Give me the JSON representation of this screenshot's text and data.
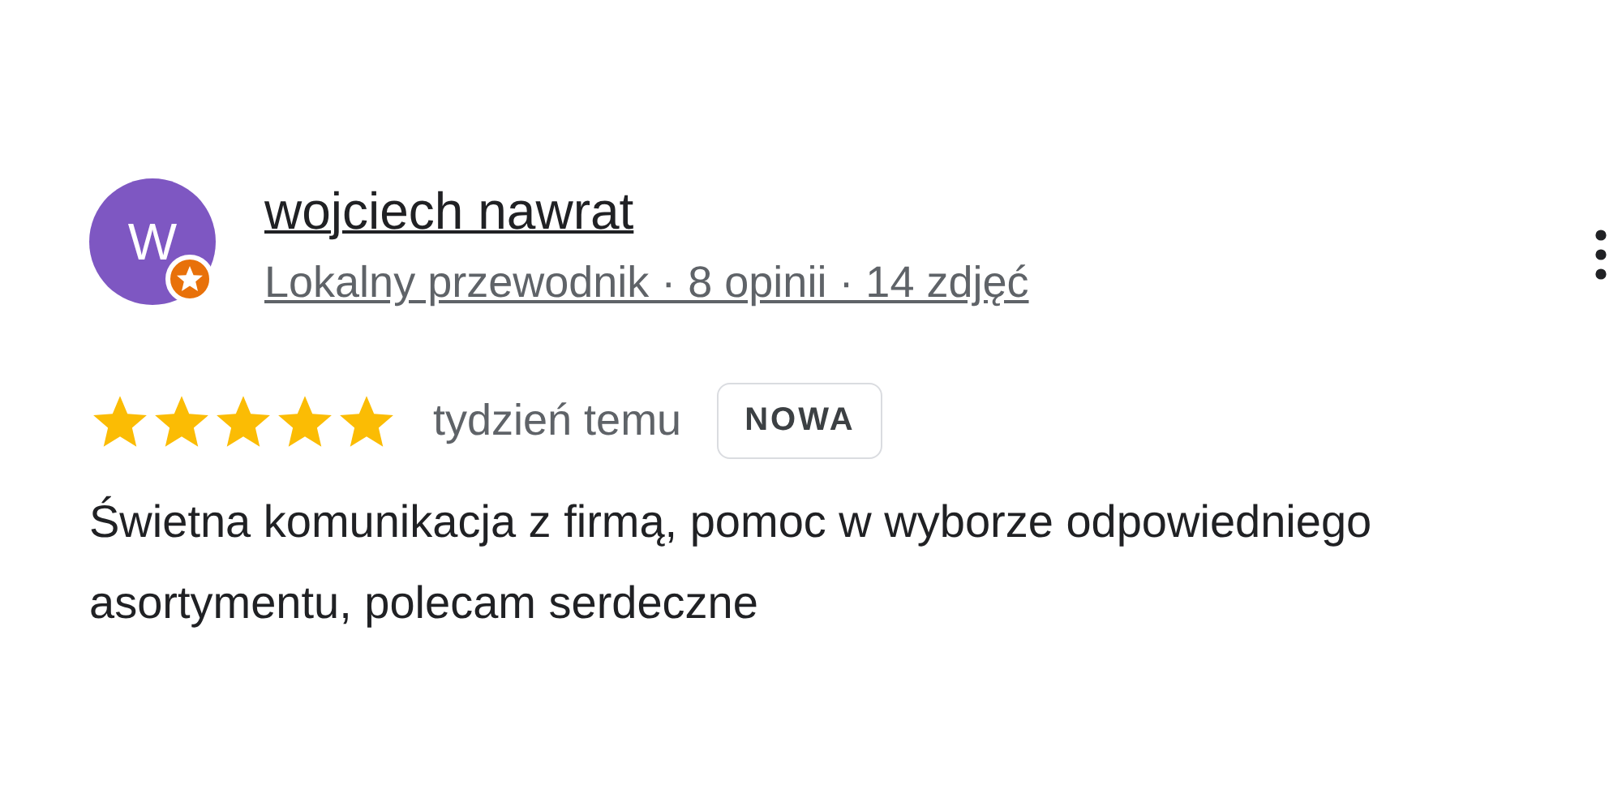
{
  "review": {
    "avatar_letter": "W",
    "local_guide": true,
    "author": "wojciech nawrat",
    "subtitle": "Lokalny przewodnik · 8 opinii · 14 zdjęć",
    "stars": 5,
    "time": "tydzień temu",
    "badge": "NOWA",
    "text": "Świetna komunikacja z firmą, pomoc w wyborze odpowiedniego asortymentu, polecam serdeczne"
  }
}
